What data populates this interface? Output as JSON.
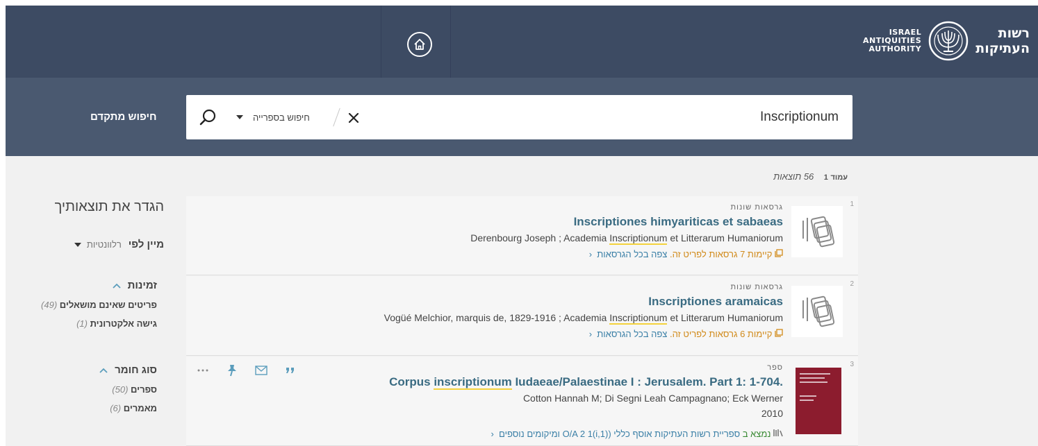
{
  "header": {
    "home_label": "home",
    "logo": {
      "en_lines": [
        "ISRAEL",
        "ANTIQUITIES",
        "AUTHORITY"
      ],
      "he_lines": [
        "רשות",
        "העתיקות"
      ]
    }
  },
  "search": {
    "advanced_label": "חיפוש מתקדם",
    "query": "Inscriptionum",
    "scope_label": "חיפוש בספרייה"
  },
  "results_info": {
    "page_label": "עמוד",
    "page_number": "1",
    "count": "56",
    "count_label": "תוצאות"
  },
  "results": [
    {
      "number": "1",
      "type": "גרסאות שונות",
      "title": "Inscriptiones himyariticas et sabaeas",
      "author_pre": "Derenbourg Joseph ; Academia ",
      "author_hl": "Inscriptionum",
      "author_post": " et Litterarum Humaniorum",
      "versions_text": "קיימות 7 גרסאות לפריט זה.",
      "versions_link": "צפה בכל הגרסאות"
    },
    {
      "number": "2",
      "type": "גרסאות שונות",
      "title": "Inscriptiones aramaicas",
      "author_pre": "Vogüé Melchior, marquis de, 1829-1916 ; Academia ",
      "author_hl": "Inscriptionum",
      "author_post": " et Litterarum Humaniorum",
      "versions_text": "קיימות 6 גרסאות לפריט זה.",
      "versions_link": "צפה בכל הגרסאות"
    },
    {
      "number": "3",
      "type": "ספר",
      "title_pre": "Corpus ",
      "title_hl": "inscriptionum",
      "title_post": " Iudaeae/Palaestinae I : Jerusalem. Part 1: 1-704.",
      "author": "Cotton Hannah M; Di Segni Leah Campagnano; Eck Werner",
      "year": "2010",
      "avail_status": "נמצא ב",
      "avail_library": "ספריית רשות העתיקות",
      "avail_collection": "אוסף כללי",
      "avail_callno": "(O/A 2 1(i,1)",
      "avail_more": "ומיקומים נוספים"
    }
  ],
  "facets": {
    "title": "הגדר את תוצאותיך",
    "sort_label": "מיין לפי",
    "sort_value": "רלוונטיות",
    "availability": {
      "title": "זמינות",
      "items": [
        {
          "label": "פריטים שאינם מושאלים",
          "count": "(49)"
        },
        {
          "label": "גישה אלקטרונית",
          "count": "(1)"
        }
      ]
    },
    "material_type": {
      "title": "סוג חומר",
      "items": [
        {
          "label": "ספרים",
          "count": "(50)"
        },
        {
          "label": "מאמרים",
          "count": "(6)"
        }
      ]
    }
  },
  "colors": {
    "topbar": "#3d4b63",
    "searchbar": "#4a5970",
    "title_link": "#3a6b82",
    "highlight": "#f4d23c",
    "versions_orange": "#d18a1a",
    "available_green": "#3a8a34"
  }
}
